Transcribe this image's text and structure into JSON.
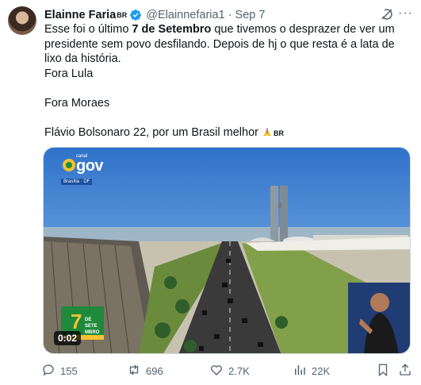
{
  "author": {
    "name": "Elainne Faria",
    "name_suffix": "BR",
    "handle": "@Elainnefaria1",
    "separator": "·",
    "date": "Sep 7"
  },
  "icons": {
    "verified": "verified-badge-icon",
    "grok": "grok-icon",
    "more": "more-icon"
  },
  "post": {
    "line1_before": "Esse foi o último ",
    "line1_bold": "7 de Setembro",
    "line1_after": " que tivemos o desprazer de ver um presidente sem povo desfilando. Depois de hj o que  resta é a lata de lixo da história.",
    "line2": "Fora Lula",
    "line3": "Fora Moraes",
    "line4": "Flávio Bolsonaro 22, por um Brasil melhor",
    "line4_tag": "BR"
  },
  "media": {
    "duration": "0:02",
    "channel_small": "canal",
    "channel": "gov",
    "channel_sub": "Brasília · DF"
  },
  "actions": {
    "replies": "155",
    "reposts": "696",
    "likes": "2.7K",
    "views": "22K"
  },
  "colors": {
    "text": "#0f1419",
    "secondary": "#536471",
    "verified": "#1d9bf0",
    "sky": "#4a90d9"
  }
}
